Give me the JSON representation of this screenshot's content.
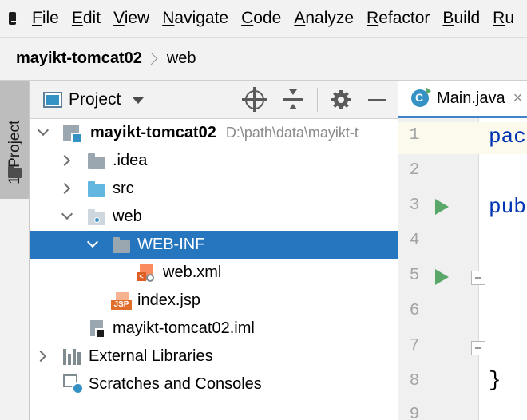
{
  "menu": {
    "items": [
      {
        "label": "File"
      },
      {
        "label": "Edit"
      },
      {
        "label": "View"
      },
      {
        "label": "Navigate"
      },
      {
        "label": "Code"
      },
      {
        "label": "Analyze"
      },
      {
        "label": "Refactor"
      },
      {
        "label": "Build"
      },
      {
        "label": "Ru"
      }
    ]
  },
  "breadcrumb": {
    "project": "mayikt-tomcat02",
    "folder": "web"
  },
  "tool_window": {
    "side_label": "1: Project",
    "title": "Project"
  },
  "tree": {
    "root": {
      "label": "mayikt-tomcat02",
      "path": "D:\\path\\data\\mayikt-t"
    },
    "idea": ".idea",
    "src": "src",
    "web": "web",
    "web_inf": "WEB-INF",
    "web_xml": "web.xml",
    "index_jsp": "index.jsp",
    "iml": "mayikt-tomcat02.iml",
    "external_libraries": "External Libraries",
    "scratches": "Scratches and Consoles"
  },
  "icons": {
    "xml_badge": "<",
    "jsp_badge": "JSP"
  },
  "editor": {
    "tab_label": "Main.java",
    "close_glyph": "×",
    "line_numbers": [
      "1",
      "2",
      "3",
      "4",
      "5",
      "6",
      "7",
      "8",
      "9"
    ],
    "code": {
      "line1": "pac",
      "line3": "pub",
      "line8": "}"
    }
  },
  "colors": {
    "selection": "#2675bf",
    "keyword": "#0033b3",
    "run_gutter": "#59a869"
  }
}
